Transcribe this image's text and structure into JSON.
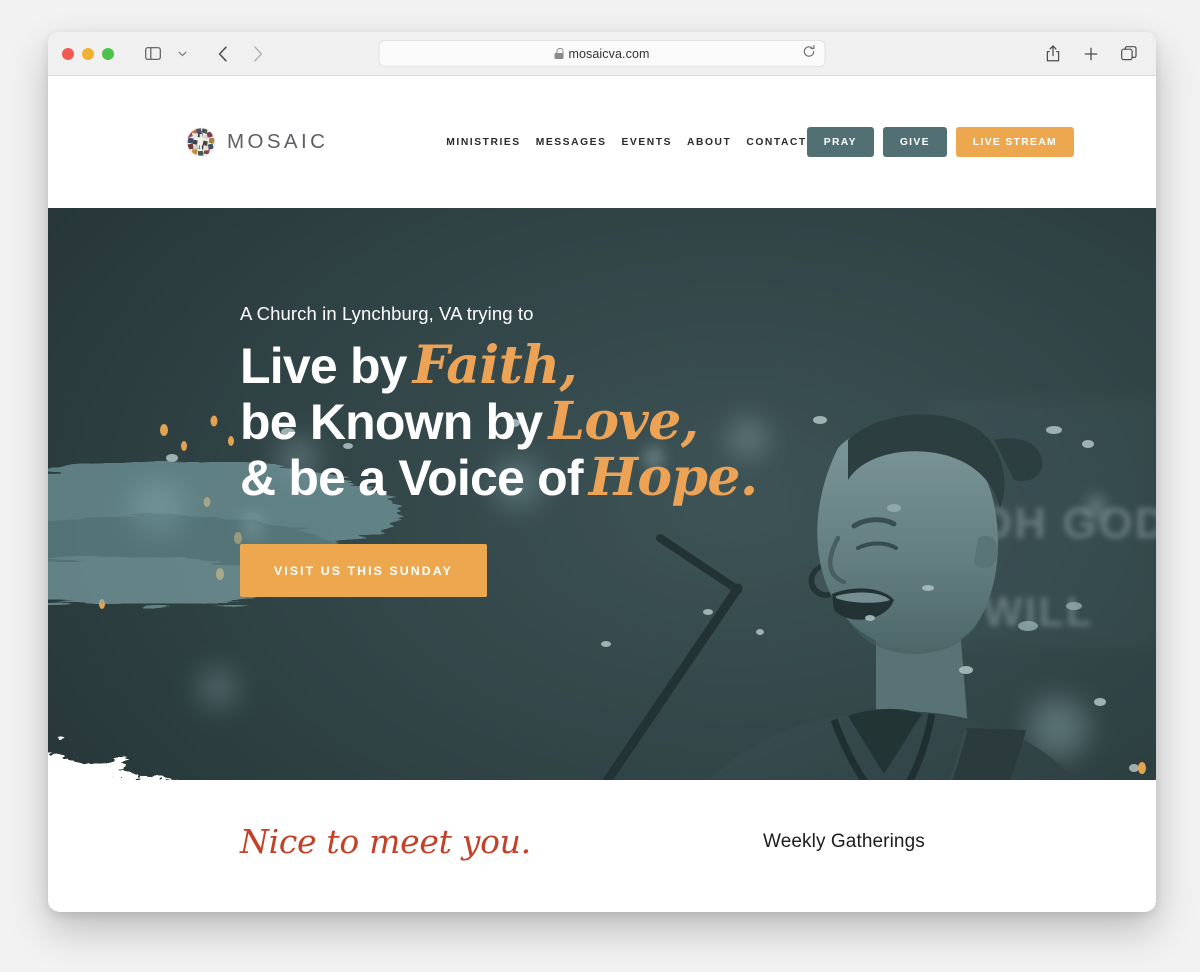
{
  "browser": {
    "app": "Safari",
    "url": "mosaicva.com",
    "secure_icon": "lock-icon",
    "traffic_lights": [
      "close",
      "minimize",
      "maximize"
    ],
    "toolbar_icons": [
      "sidebar-icon",
      "chevron-down-icon",
      "back-icon",
      "forward-icon",
      "shield-icon",
      "reload-icon",
      "share-icon",
      "new-tab-icon",
      "tab-overview-icon"
    ]
  },
  "site": {
    "brand": {
      "name": "MOSAIC",
      "mark": "mosaic-circle-logo"
    },
    "nav": [
      {
        "label": "MINISTRIES"
      },
      {
        "label": "MESSAGES"
      },
      {
        "label": "EVENTS"
      },
      {
        "label": "ABOUT"
      },
      {
        "label": "CONTACT"
      }
    ],
    "header_buttons": [
      {
        "label": "PRAY",
        "style": "teal"
      },
      {
        "label": "GIVE",
        "style": "teal"
      },
      {
        "label": "LIVE STREAM",
        "style": "orange"
      }
    ],
    "hero": {
      "kicker": "A Church in Lynchburg, VA trying to",
      "lines": [
        {
          "bold": "Live by",
          "script": "Faith,"
        },
        {
          "bold": "be Known by",
          "script": "Love,"
        },
        {
          "bold": "& be a Voice of",
          "script": "Hope."
        }
      ],
      "cta": "VISIT US THIS SUNDAY",
      "image_alt": "worship-leader-singing-with-guitar",
      "projected_text": "OH GOD"
    },
    "below_fold": {
      "script_heading": "Nice to meet you.",
      "section_heading": "Weekly Gatherings"
    }
  },
  "colors": {
    "teal_button": "#527074",
    "orange": "#eda84f",
    "script_orange": "#eda356",
    "hero_dark": "#2e3c3b",
    "brush_teal": "#6d9499",
    "red_script": "#c44027",
    "brand_text": "#5d6064"
  }
}
